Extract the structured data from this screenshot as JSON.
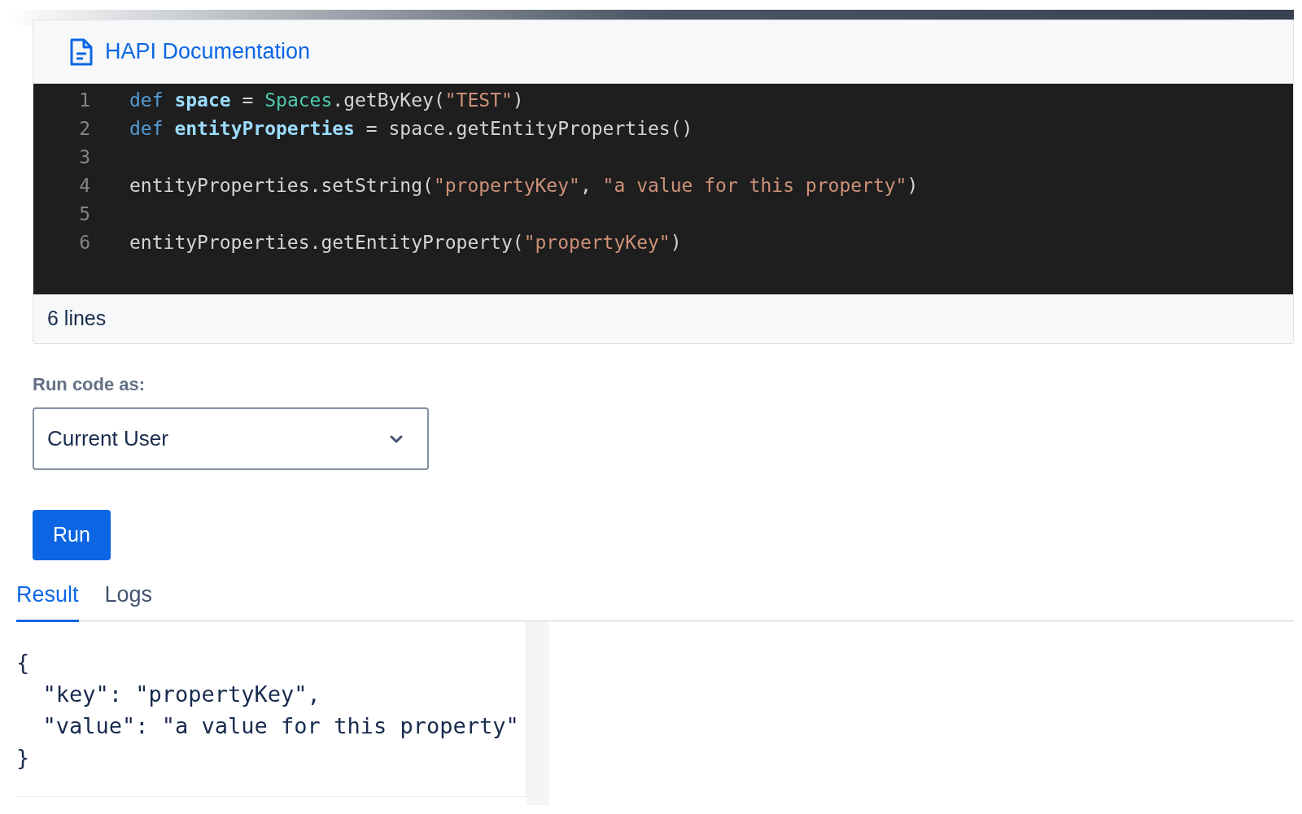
{
  "header": {
    "title": "HAPI Documentation"
  },
  "code": {
    "lines": [
      {
        "number": "1",
        "tokens": [
          {
            "text": "def",
            "kind": "keyword"
          },
          {
            "text": " space",
            "kind": "variable"
          },
          {
            "text": " = ",
            "kind": "plain"
          },
          {
            "text": "Spaces",
            "kind": "class"
          },
          {
            "text": ".getByKey(",
            "kind": "plain"
          },
          {
            "text": "\"TEST\"",
            "kind": "string"
          },
          {
            "text": ")",
            "kind": "plain"
          }
        ]
      },
      {
        "number": "2",
        "tokens": [
          {
            "text": "def",
            "kind": "keyword"
          },
          {
            "text": " entityProperties",
            "kind": "variable"
          },
          {
            "text": " = space.getEntityProperties()",
            "kind": "plain"
          }
        ]
      },
      {
        "number": "3"
      },
      {
        "number": "4",
        "tokens": [
          {
            "text": "entityProperties.setString(",
            "kind": "plain"
          },
          {
            "text": "\"propertyKey\"",
            "kind": "string"
          },
          {
            "text": ", ",
            "kind": "plain"
          },
          {
            "text": "\"a value for this property\"",
            "kind": "string"
          },
          {
            "text": ")",
            "kind": "plain"
          }
        ]
      },
      {
        "number": "5"
      },
      {
        "number": "6",
        "tokens": [
          {
            "text": "entityProperties.getEntityProperty(",
            "kind": "plain"
          },
          {
            "text": "\"propertyKey\"",
            "kind": "string"
          },
          {
            "text": ")",
            "kind": "plain"
          }
        ]
      }
    ],
    "footer": "6 lines"
  },
  "run_as": {
    "label": "Run code as:",
    "value": "Current User"
  },
  "run_button": "Run",
  "tabs": [
    {
      "label": "Result",
      "selected": true
    },
    {
      "label": "Logs",
      "selected": false
    }
  ],
  "result": [
    "{",
    "  \"key\": \"propertyKey\",",
    "  \"value\": \"a value for this property\"",
    "}"
  ]
}
